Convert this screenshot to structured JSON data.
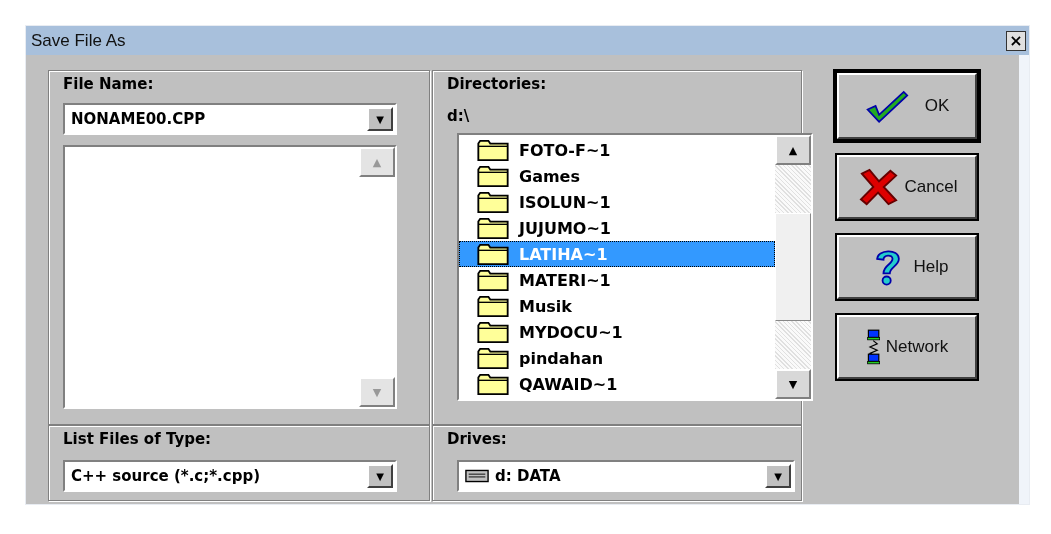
{
  "window": {
    "title": "Save File As",
    "close": "×"
  },
  "file_name": {
    "label": "File Name:",
    "value": "NONAME00.CPP",
    "dropdown": "▼"
  },
  "file_list": {
    "scroll_up": "▲",
    "scroll_down": "▼"
  },
  "file_type": {
    "label": "List Files of Type:",
    "value": "C++ source (*.c;*.cpp)",
    "dropdown": "▼"
  },
  "directories": {
    "label": "Directories:",
    "path": "d:\\",
    "scroll_up": "▲",
    "scroll_down": "▼",
    "items": [
      {
        "name": "FOTO-F~1",
        "selected": false
      },
      {
        "name": "Games",
        "selected": false
      },
      {
        "name": "ISOLUN~1",
        "selected": false
      },
      {
        "name": "JUJUMO~1",
        "selected": false
      },
      {
        "name": "LATIHA~1",
        "selected": true
      },
      {
        "name": "MATERI~1",
        "selected": false
      },
      {
        "name": "Musik",
        "selected": false
      },
      {
        "name": "MYDOCU~1",
        "selected": false
      },
      {
        "name": "pindahan",
        "selected": false
      },
      {
        "name": "QAWAID~1",
        "selected": false
      }
    ]
  },
  "drives": {
    "label": "Drives:",
    "value": "d: DATA",
    "dropdown": "▼"
  },
  "buttons": [
    {
      "kind": "ok",
      "label": "OK",
      "default": true
    },
    {
      "kind": "cancel",
      "label": "Cancel",
      "default": false
    },
    {
      "kind": "help",
      "label": "Help",
      "default": false
    },
    {
      "kind": "network",
      "label": "Network",
      "default": false
    }
  ]
}
